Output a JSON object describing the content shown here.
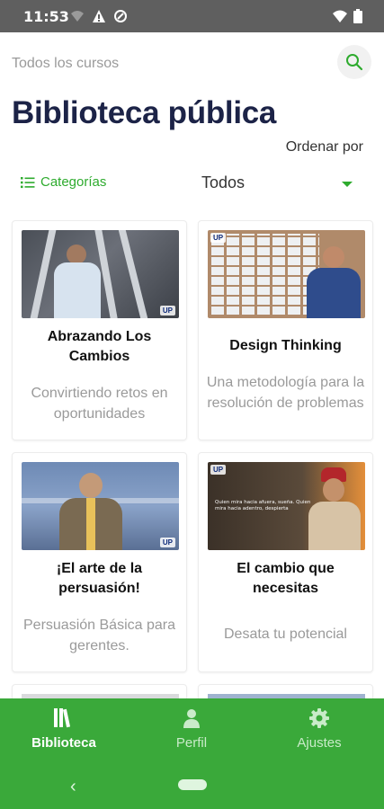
{
  "status_bar": {
    "time": "11:53"
  },
  "header": {
    "breadcrumb": "Todos los cursos",
    "title": "Biblioteca pública",
    "sort_label": "Ordenar por"
  },
  "filters": {
    "categories_label": "Categorías",
    "selected": "Todos"
  },
  "courses": [
    {
      "title": "Abrazando Los Cambios",
      "description": "Convirtiendo retos en oportunidades"
    },
    {
      "title": "Design Thinking",
      "description": "Una metodología para la resolución de problemas"
    },
    {
      "title": "¡El arte de la persuasión!",
      "description": "Persuasión Básica para gerentes."
    },
    {
      "title": "El cambio que necesitas",
      "description": "Desata tu potencial"
    }
  ],
  "image_text": {
    "logo": "UP",
    "quote": "Quien mira hacia afuera, sueña. Quien mira hacia adentro, despierta"
  },
  "bottom_nav": [
    {
      "label": "Biblioteca",
      "icon": "books-icon",
      "active": true
    },
    {
      "label": "Perfil",
      "icon": "person-icon",
      "active": false
    },
    {
      "label": "Ajustes",
      "icon": "gear-icon",
      "active": false
    }
  ],
  "colors": {
    "accent": "#2eab2e",
    "nav_bg": "#3aa93a",
    "title": "#1c2347"
  }
}
